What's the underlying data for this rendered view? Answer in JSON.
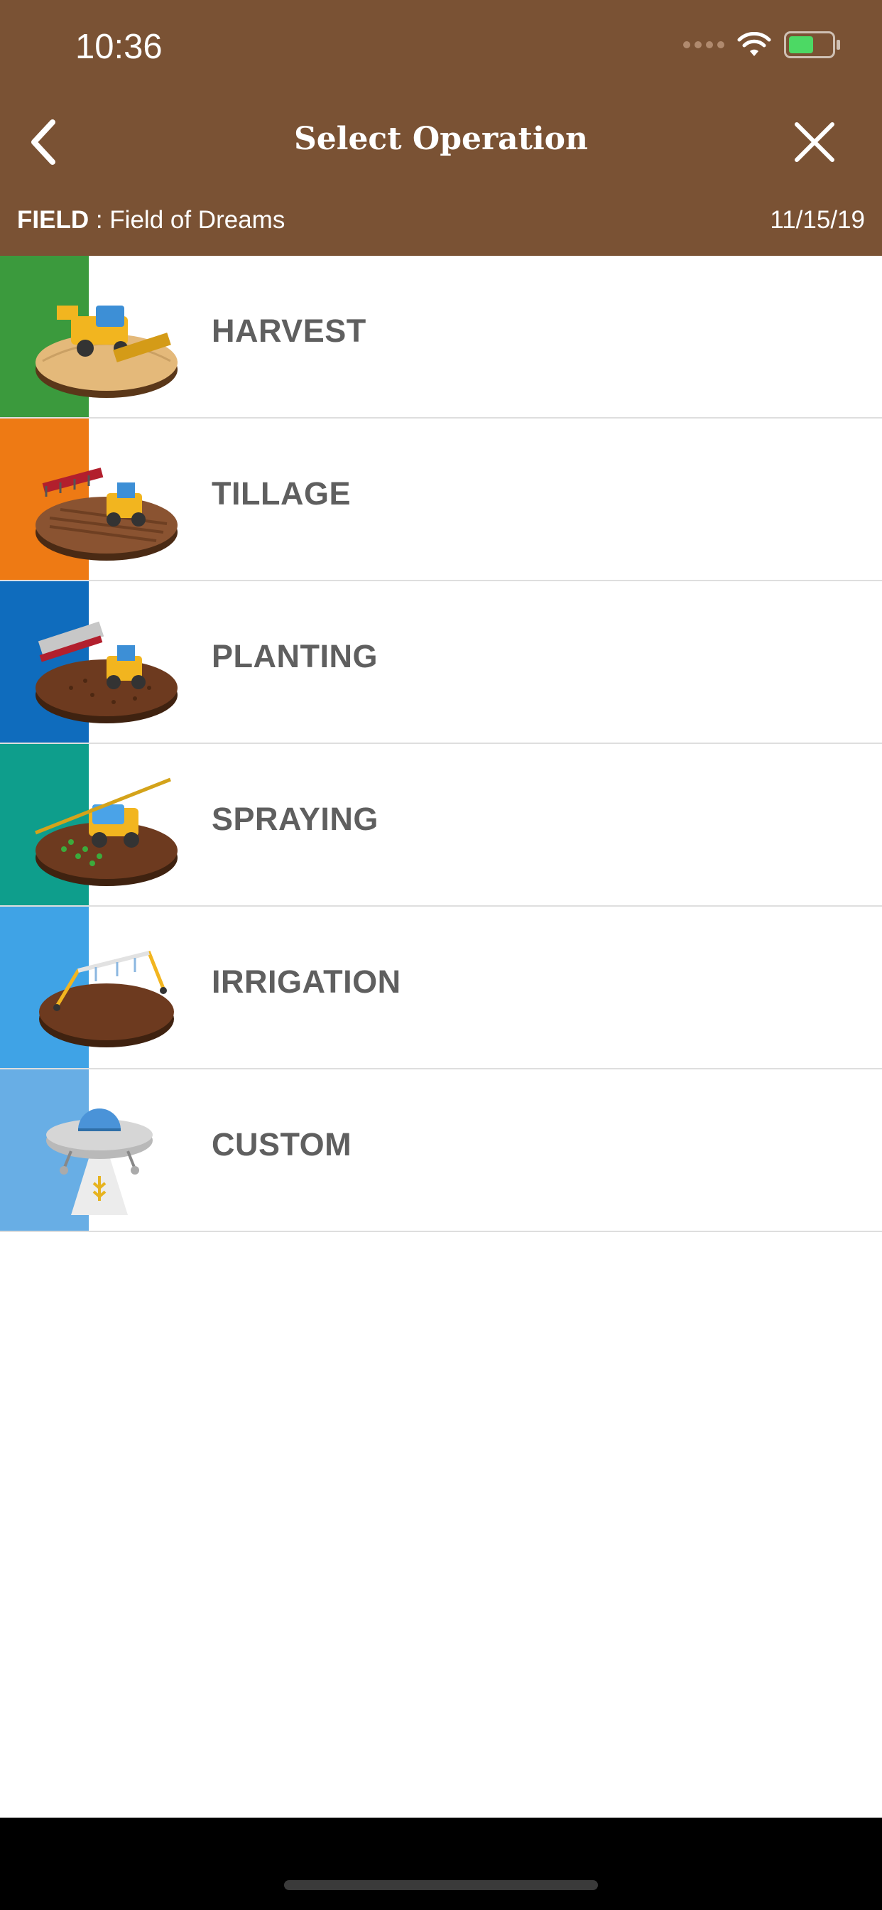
{
  "status_bar": {
    "time": "10:36"
  },
  "header": {
    "title": "Select Operation",
    "field_label": "FIELD",
    "field_separator": " : ",
    "field_name": "Field of Dreams",
    "date": "11/15/19",
    "colors": {
      "background": "#7a5234",
      "text": "#ffffff"
    }
  },
  "operations": [
    {
      "label": "HARVEST",
      "stripe_color": "#3b9a3d",
      "icon": "harvest-combine-icon"
    },
    {
      "label": "TILLAGE",
      "stripe_color": "#ee7a14",
      "icon": "tillage-tractor-icon"
    },
    {
      "label": "PLANTING",
      "stripe_color": "#0f6cbd",
      "icon": "planting-seeder-icon"
    },
    {
      "label": "SPRAYING",
      "stripe_color": "#0e9e8c",
      "icon": "spraying-sprayer-icon"
    },
    {
      "label": "IRRIGATION",
      "stripe_color": "#3fa3e6",
      "icon": "irrigation-pivot-icon"
    },
    {
      "label": "CUSTOM",
      "stripe_color": "#68aee5",
      "icon": "custom-ufo-icon"
    }
  ]
}
